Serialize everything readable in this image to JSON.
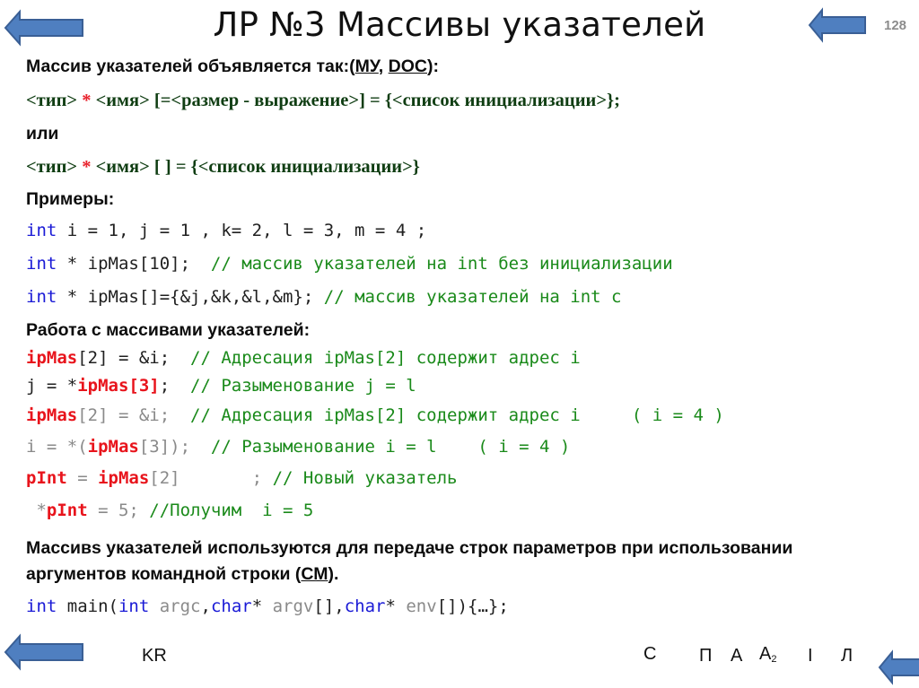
{
  "slide": {
    "title": "ЛР №3 Массивы указателей",
    "number": "128"
  },
  "declaration": {
    "intro_text": "Массив указателей объявляется так:(",
    "link_mu": "МУ",
    "separator": ", ",
    "link_doc": "DOC",
    "intro_end": "):",
    "syntax1_a": "<тип> ",
    "syntax1_star": "*",
    "syntax1_b": " <имя> [=<размер - выражение>]  = {<список инициализации>};",
    "or_label": "или",
    "syntax2_a": " <тип> ",
    "syntax2_star": "*",
    "syntax2_b": " <имя> [ ] = {<список инициализации>}"
  },
  "examples": {
    "heading": "Примеры:",
    "line1": {
      "kw": "int",
      "rest": " i = 1, j = 1 , k= 2, l = 3, m = 4 ;"
    },
    "line2": {
      "kw": "int",
      "code": " * ipMas[10];  ",
      "comment": "// массив указателей на int без инициализации"
    },
    "line3": {
      "kw": "int",
      "code": " * ipMas[]={&j,&k,&l,&m}; ",
      "comment": "// массив указателей на int с"
    }
  },
  "work": {
    "heading": "Работа с массивами указателей:",
    "line1": {
      "var": "ipMas",
      "code": "[2] = &i;  ",
      "comment": "// Адресация ipMas[2] содержит адрес i"
    },
    "line2": {
      "pre": "j = *",
      "var": "ipMas[3]",
      "code": ";  ",
      "comment": "// Разыменование j = l"
    },
    "line3": {
      "var": "ipMas",
      "code": "[2] = &i;  ",
      "comment": "// Адресация ipMas[2] содержит адрес i     ( i = 4 )"
    },
    "line4": {
      "pre": "i = *(",
      "var": "ipMas",
      "code": "[3]);  ",
      "comment": "// Разыменование i = l    ( i = 4 )"
    },
    "line5": {
      "var1": "pInt",
      "mid": " = ",
      "var2": "ipMas",
      "code": "[2]       ; ",
      "comment": "// Новый указатель"
    },
    "line6": {
      "pre": " *",
      "var": "pInt",
      "code": " = 5; ",
      "comment": "//Получим  i = 5"
    }
  },
  "argv": {
    "text1": "Массивs указателей используются для передаче строк параметров при использовании",
    "text2_a": "аргументов командной строки (",
    "text2_link": "СМ",
    "text2_b": ").",
    "code": {
      "kw1": "int",
      "t1": " main(",
      "kw2": "int",
      "p1": " argc",
      "t2": ",",
      "kw3": "char",
      "t3": "* ",
      "p2": "argv",
      "t4": "[],",
      "kw4": "char",
      "t5": "* ",
      "p3": "env",
      "t6": "[]){…};"
    }
  },
  "footer": {
    "kr": "KR",
    "nav": [
      "С",
      "П",
      "А",
      "А",
      "І",
      "Л"
    ],
    "nav_sub": "2"
  },
  "icons": {
    "back_arrow": "left-arrow-icon"
  },
  "colors": {
    "arrow_fill": "#4f7fc0",
    "arrow_stroke": "#3a5f95",
    "keyword": "#1a1ad6",
    "comment": "#1a8a1a",
    "highlight": "#e8141c",
    "syntax": "#0f3d12"
  }
}
